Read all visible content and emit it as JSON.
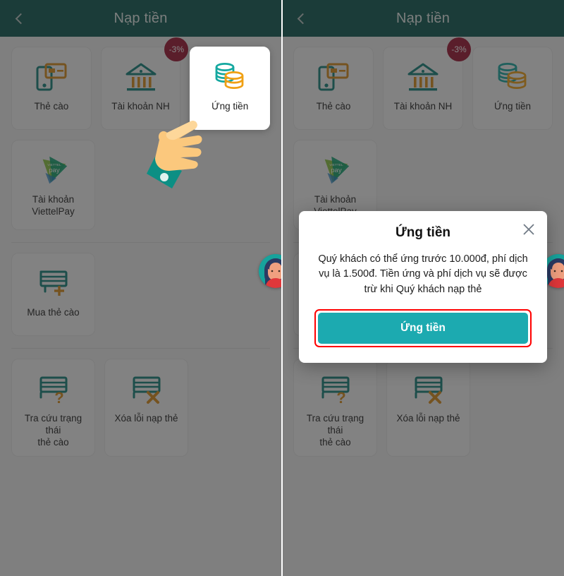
{
  "header": {
    "title": "Nạp tiền",
    "back_icon": "chevron-left-icon"
  },
  "cards": {
    "row1": [
      {
        "label": "Thẻ cào",
        "icon": "phone-card-icon",
        "badge": null
      },
      {
        "label": "Tài khoản NH",
        "icon": "bank-icon",
        "badge": "-3%"
      },
      {
        "label": "Ứng tiền",
        "icon": "coins-icon",
        "badge": null
      }
    ],
    "row2": [
      {
        "label": "Tài khoản\nViettelPay",
        "label_line1": "Tài khoản",
        "label_line2": "ViettelPay",
        "icon": "viettelpay-logo-icon",
        "badge": null
      }
    ],
    "row3": [
      {
        "label": "Mua thẻ cào",
        "icon": "card-plus-icon",
        "badge": null
      }
    ],
    "row4": [
      {
        "label_line1": "Tra cứu trạng thái",
        "label_line2": "thẻ cào",
        "icon": "card-question-icon",
        "badge": null
      },
      {
        "label_line1": "Xóa lỗi nạp thẻ",
        "label_line2": "",
        "icon": "card-x-icon",
        "badge": null
      }
    ]
  },
  "modal": {
    "title": "Ứng tiền",
    "body": "Quý khách có thể ứng trước 10.000đ, phí dịch vụ là 1.500đ. Tiền ứng và phí dịch vụ sẽ được trừ khi Quý khách nạp thẻ",
    "button_label": "Ứng tiền",
    "close_icon": "close-icon"
  },
  "annotation": {
    "hand_icon": "pointing-hand-icon",
    "highlight_color": "#ff0000"
  },
  "support": {
    "avatar_icon": "support-agent-avatar"
  },
  "colors": {
    "header_bg": "#0b5650",
    "page_bg": "#f2f2f2",
    "card_bg": "#f7f7f7",
    "accent_teal": "#0e7f7a",
    "accent_orange": "#d98b16",
    "badge_red": "#9b1230",
    "button_teal": "#1caab0",
    "highlight_red": "#ff0000"
  }
}
